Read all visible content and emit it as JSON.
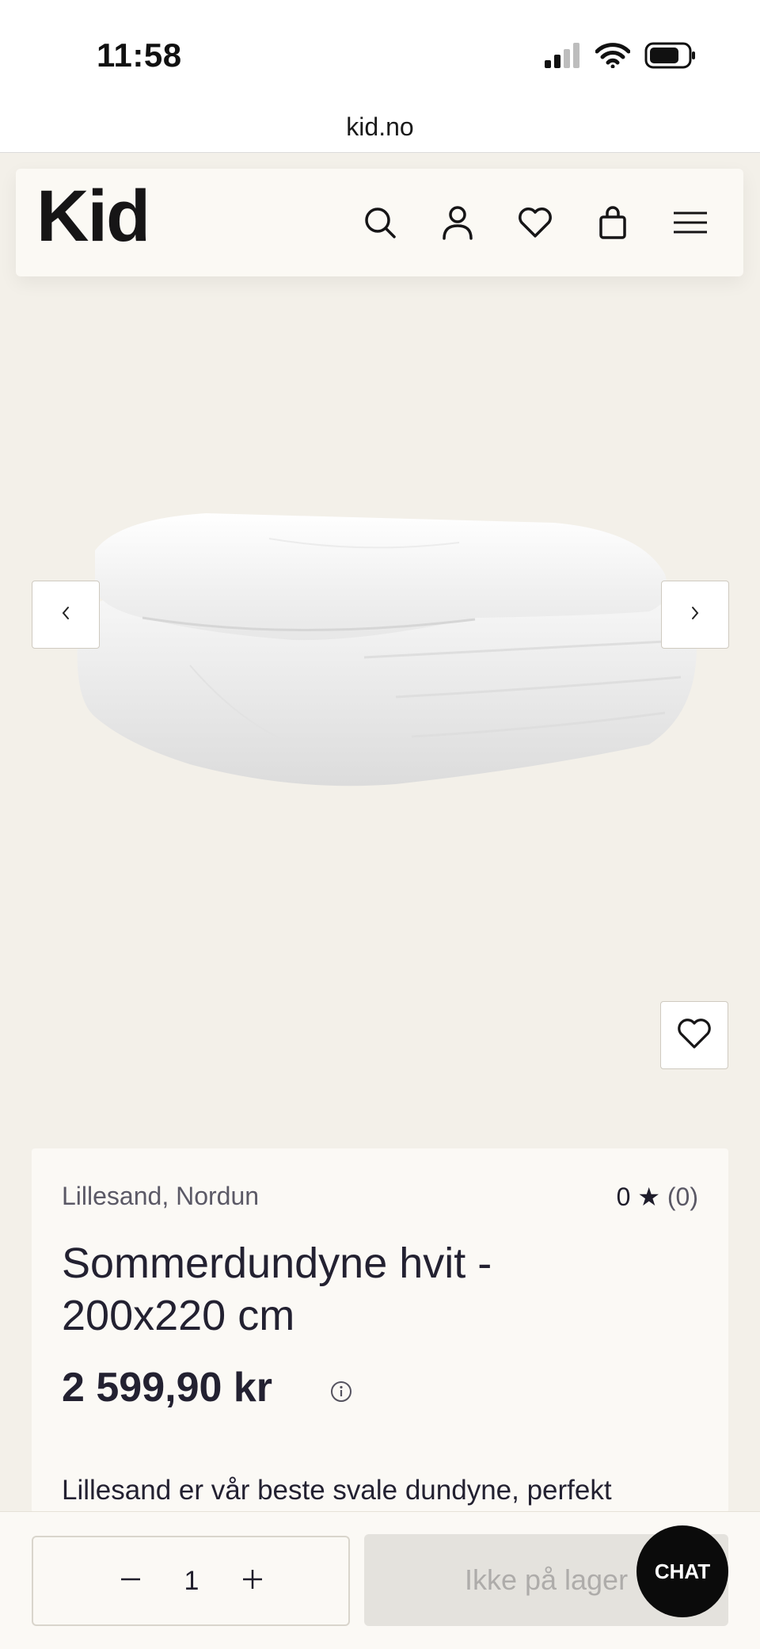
{
  "status_bar": {
    "time": "11:58",
    "icons": [
      "cellular-signal-icon",
      "wifi-icon",
      "battery-icon"
    ]
  },
  "browser": {
    "url": "kid.no"
  },
  "header": {
    "logo": "Kid",
    "icons": [
      "search-icon",
      "user-icon",
      "heart-icon",
      "bag-icon",
      "menu-icon"
    ]
  },
  "gallery": {
    "image": "duvet-image",
    "prev_icon": "chevron-left-icon",
    "next_icon": "chevron-right-icon",
    "favorite_icon": "heart-icon"
  },
  "product": {
    "brand": "Lillesand, Nordun",
    "rating_value": "0",
    "rating_star": "★",
    "rating_count": "(0)",
    "title": "Sommerdundyne hvit - 200x220 cm",
    "price": "2 599,90 kr",
    "price_info_icon": "info-icon",
    "description": "Lillesand er vår beste svale dundyne, perfekt"
  },
  "cart": {
    "minus_icon": "minus-icon",
    "quantity": "1",
    "plus_icon": "plus-icon",
    "stock_label": "Ikke på lager"
  },
  "chat": {
    "label": "CHAT"
  },
  "colors": {
    "page_bg": "#f3f0e9",
    "card_bg": "#fbf9f5",
    "text": "#1f1d2b",
    "muted": "#5b5966",
    "disabled_bg": "#e4e2dd",
    "disabled_text": "#aeacaa",
    "chat_bg": "#0b0b0b"
  }
}
